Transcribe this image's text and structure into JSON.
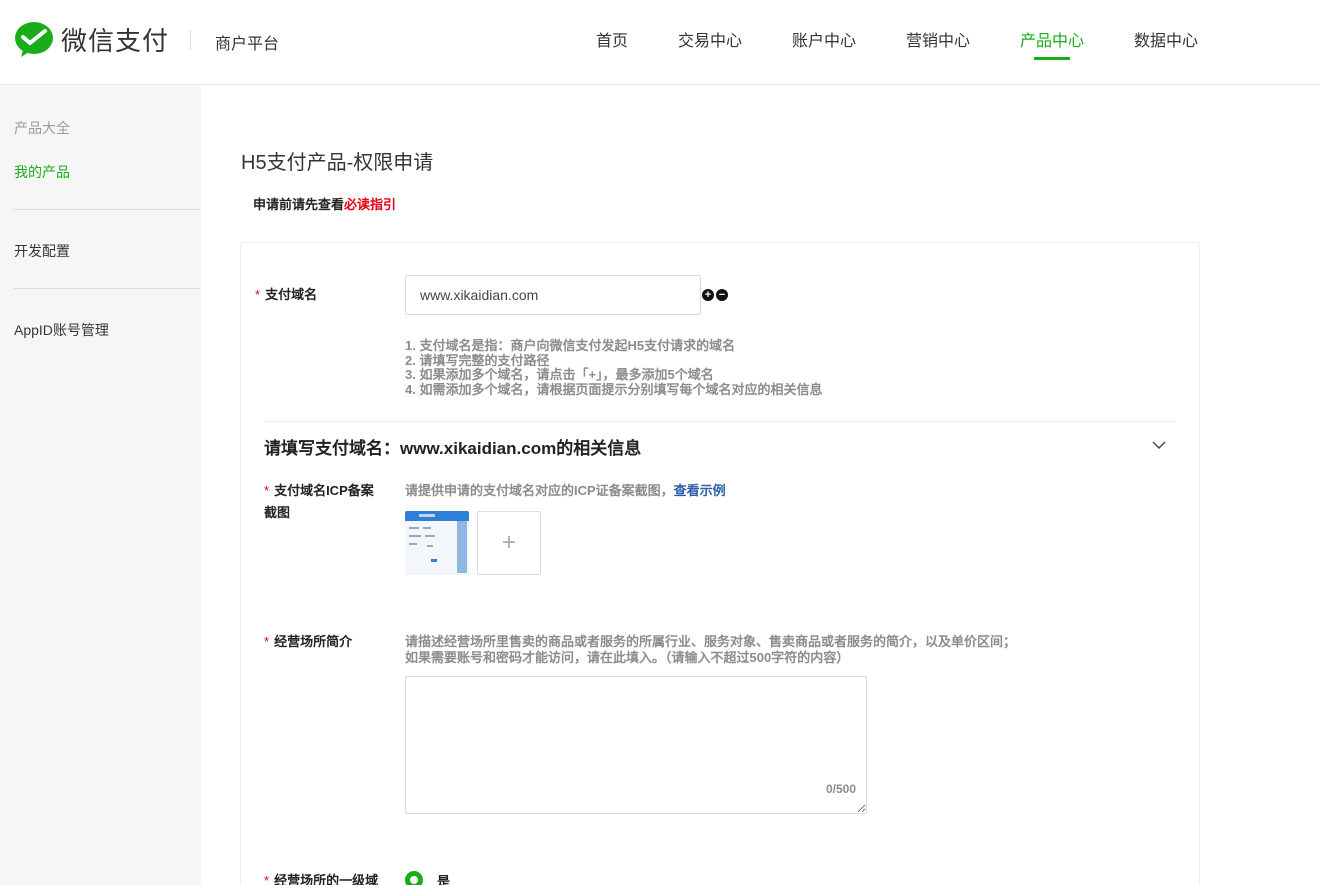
{
  "header": {
    "brand": "微信支付",
    "platform": "商户平台",
    "nav": [
      {
        "label": "首页"
      },
      {
        "label": "交易中心"
      },
      {
        "label": "账户中心"
      },
      {
        "label": "营销中心"
      },
      {
        "label": "产品中心"
      },
      {
        "label": "数据中心"
      }
    ],
    "active_nav": "产品中心",
    "accent_color": "#1aad19"
  },
  "sidebar": {
    "items": [
      {
        "label": "产品大全"
      },
      {
        "label": "我的产品"
      },
      {
        "label": "开发配置"
      },
      {
        "label": "AppID账号管理"
      }
    ],
    "active_item": "我的产品"
  },
  "main": {
    "title": "H5支付产品-权限申请",
    "guide_text": "申请前请先查看",
    "guide_link": "必读指引",
    "domain_field": {
      "label": "支付域名",
      "value": "www.xikaidian.com",
      "add_icon": "plus-circle-icon",
      "remove_icon": "minus-circle-icon"
    },
    "hints": [
      "1. 支付域名是指：商户向微信支付发起H5支付请求的域名",
      "2. 请填写完整的支付路径",
      "3. 如果添加多个域名，请点击「+」，最多添加5个域名",
      "4. 如需添加多个域名，请根据页面提示分别填写每个域名对应的相关信息"
    ],
    "section": {
      "title": "请填写支付域名：www.xikaidian.com的相关信息",
      "chevron_icon": "chevron-down-icon"
    },
    "icp": {
      "label_line1": "支付域名ICP备案",
      "label_line2": "截图",
      "desc": "请提供申请的支付域名对应的ICP证备案截图，",
      "example_link": "查看示例",
      "upload_symbol": "+"
    },
    "intro": {
      "label": "经营场所简介",
      "desc_line1": "请描述经营场所里售卖的商品或者服务的所属行业、服务对象、售卖商品或者服务的简介，以及单价区间；",
      "desc_line2": "如果需要账号和密码才能访问，请在此填入。（请输入不超过500字符的内容）",
      "value": "",
      "counter": "0/500"
    },
    "level1": {
      "label": "经营场所的一级域",
      "option": "是"
    }
  }
}
